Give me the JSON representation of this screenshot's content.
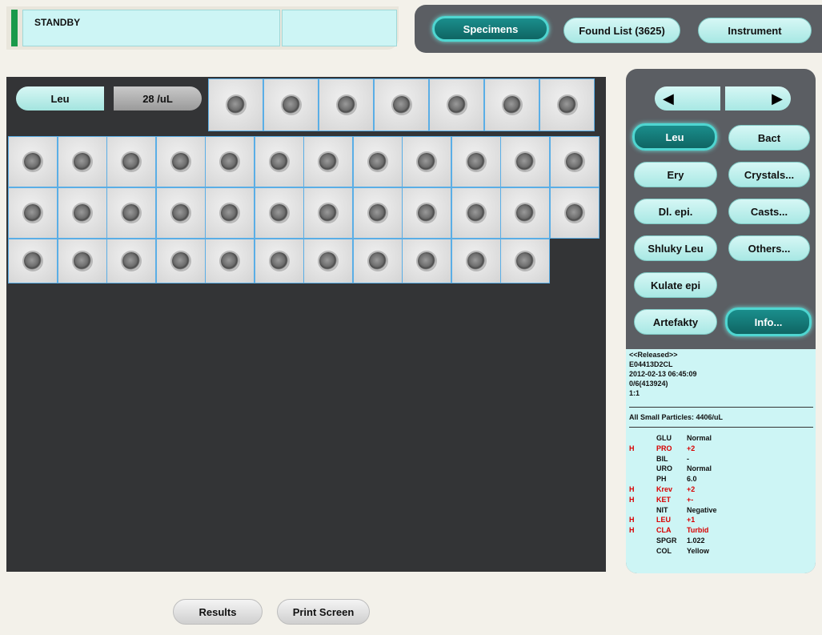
{
  "status": {
    "text": "STANDBY",
    "side_text": ""
  },
  "nav": {
    "specimens": "Specimens",
    "found_list": "Found List (3625)",
    "instrument": "Instrument"
  },
  "image_area": {
    "category": "Leu",
    "count": "28 /uL"
  },
  "categories": {
    "leu": "Leu",
    "bact": "Bact",
    "ery": "Ery",
    "crystals": "Crystals...",
    "dl_epi": "Dl. epi.",
    "casts": "Casts...",
    "shluky_leu": "Shluky Leu",
    "others": "Others...",
    "kulate_epi": "Kulate epi",
    "artefakty": "Artefakty",
    "info": "Info..."
  },
  "info": {
    "released": "<<Released>>",
    "sample_id": "E04413D2CL",
    "datetime": "2012-02-13 06:45:09",
    "rack": "0/6(413924)",
    "dilution": "1:1",
    "small_particles": "All Small Particles: 4406/uL"
  },
  "tests": [
    {
      "flag": "",
      "name": "GLU",
      "value": "Normal",
      "abnormal": false
    },
    {
      "flag": "H",
      "name": "PRO",
      "value": "+2",
      "abnormal": true
    },
    {
      "flag": "",
      "name": "BIL",
      "value": "-",
      "abnormal": false
    },
    {
      "flag": "",
      "name": "URO",
      "value": "Normal",
      "abnormal": false
    },
    {
      "flag": "",
      "name": "PH",
      "value": "6.0",
      "abnormal": false
    },
    {
      "flag": "H",
      "name": "Krev",
      "value": "+2",
      "abnormal": true
    },
    {
      "flag": "H",
      "name": "KET",
      "value": "+-",
      "abnormal": true
    },
    {
      "flag": "",
      "name": "NIT",
      "value": "Negative",
      "abnormal": false
    },
    {
      "flag": "H",
      "name": "LEU",
      "value": "+1",
      "abnormal": true
    },
    {
      "flag": "H",
      "name": "CLA",
      "value": "Turbid",
      "abnormal": true
    },
    {
      "flag": "",
      "name": "SPGR",
      "value": "1.022",
      "abnormal": false
    },
    {
      "flag": "",
      "name": "COL",
      "value": "Yellow",
      "abnormal": false
    }
  ],
  "bottom": {
    "results": "Results",
    "print_screen": "Print Screen"
  },
  "colors": {
    "accent": "#0f6563",
    "abnormal": "#d90000",
    "panel": "#cdf5f5"
  }
}
